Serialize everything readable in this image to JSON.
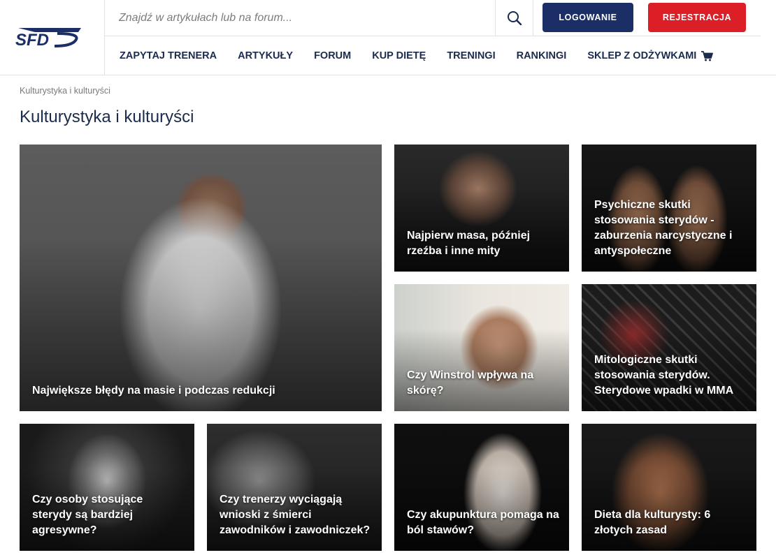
{
  "search": {
    "placeholder": "Znajdź w artykułach lub na forum..."
  },
  "auth": {
    "login_label": "LOGOWANIE",
    "register_label": "REJESTRACJA"
  },
  "brand": {
    "logo_text": "SFD",
    "primary_color": "#1b2f66",
    "accent_color": "#dc1f26"
  },
  "nav": {
    "items": [
      {
        "label": "ZAPYTAJ TRENERA"
      },
      {
        "label": "ARTYKUŁY"
      },
      {
        "label": "FORUM"
      },
      {
        "label": "KUP DIETĘ"
      },
      {
        "label": "TRENINGI"
      },
      {
        "label": "RANKINGI"
      },
      {
        "label": "SKLEP Z ODŻYWKAMI",
        "icon": "cart-icon"
      }
    ]
  },
  "breadcrumb": "Kulturystyka i kulturyści",
  "page_title": "Kulturystyka i kulturyści",
  "articles": [
    {
      "title": "Największe błędy na masie i podczas redukcji"
    },
    {
      "title": "Najpierw masa, później rzeźba i inne mity"
    },
    {
      "title": "Psychiczne skutki stosowania sterydów - zaburzenia narcystyczne i antyspołeczne"
    },
    {
      "title": "Czy Winstrol wpływa na skórę?"
    },
    {
      "title": "Mitologiczne skutki stosowania sterydów. Sterydowe wpadki w MMA"
    },
    {
      "title": "Czy osoby stosujące sterydy są bardziej agresywne?"
    },
    {
      "title": "Czy trenerzy wyciągają wnioski z śmierci zawodników i zawodniczek?"
    },
    {
      "title": "Czy akupunktura pomaga na ból stawów?"
    },
    {
      "title": "Dieta dla kulturysty: 6 złotych zasad"
    }
  ]
}
